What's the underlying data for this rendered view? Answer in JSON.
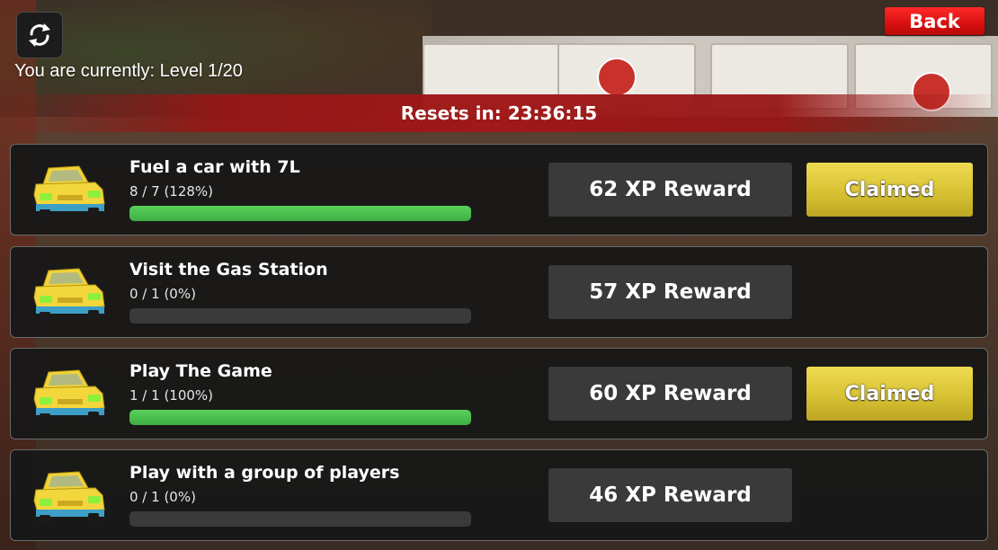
{
  "header": {
    "level_text": "You are currently: Level 1/20",
    "back_label": "Back",
    "reset_text": "Resets in: 23:36:15",
    "refresh_icon": "refresh-icon"
  },
  "colors": {
    "back_button": "#e01010",
    "reset_bar": "#a01818",
    "claim_button": "#d8c233",
    "progress_fill": "#45b84a",
    "reward_box": "#3a3a3a",
    "panel": "#181818"
  },
  "quests": [
    {
      "title": "Fuel a car with 7L",
      "progress_text": "8 / 7 (128%)",
      "progress_fraction": 1.0,
      "reward": "62 XP Reward",
      "claim_label": "Claimed",
      "claimed": true,
      "icon": "yellow-car-icon"
    },
    {
      "title": "Visit the Gas Station",
      "progress_text": "0 / 1 (0%)",
      "progress_fraction": 0.0,
      "reward": "57 XP Reward",
      "claim_label": "",
      "claimed": false,
      "icon": "yellow-car-icon"
    },
    {
      "title": "Play The Game",
      "progress_text": "1 / 1 (100%)",
      "progress_fraction": 1.0,
      "reward": "60 XP Reward",
      "claim_label": "Claimed",
      "claimed": true,
      "icon": "yellow-car-icon"
    },
    {
      "title": "Play with a group of players",
      "progress_text": "0 / 1 (0%)",
      "progress_fraction": 0.0,
      "reward": "46 XP Reward",
      "claim_label": "",
      "claimed": false,
      "icon": "yellow-car-icon"
    }
  ]
}
